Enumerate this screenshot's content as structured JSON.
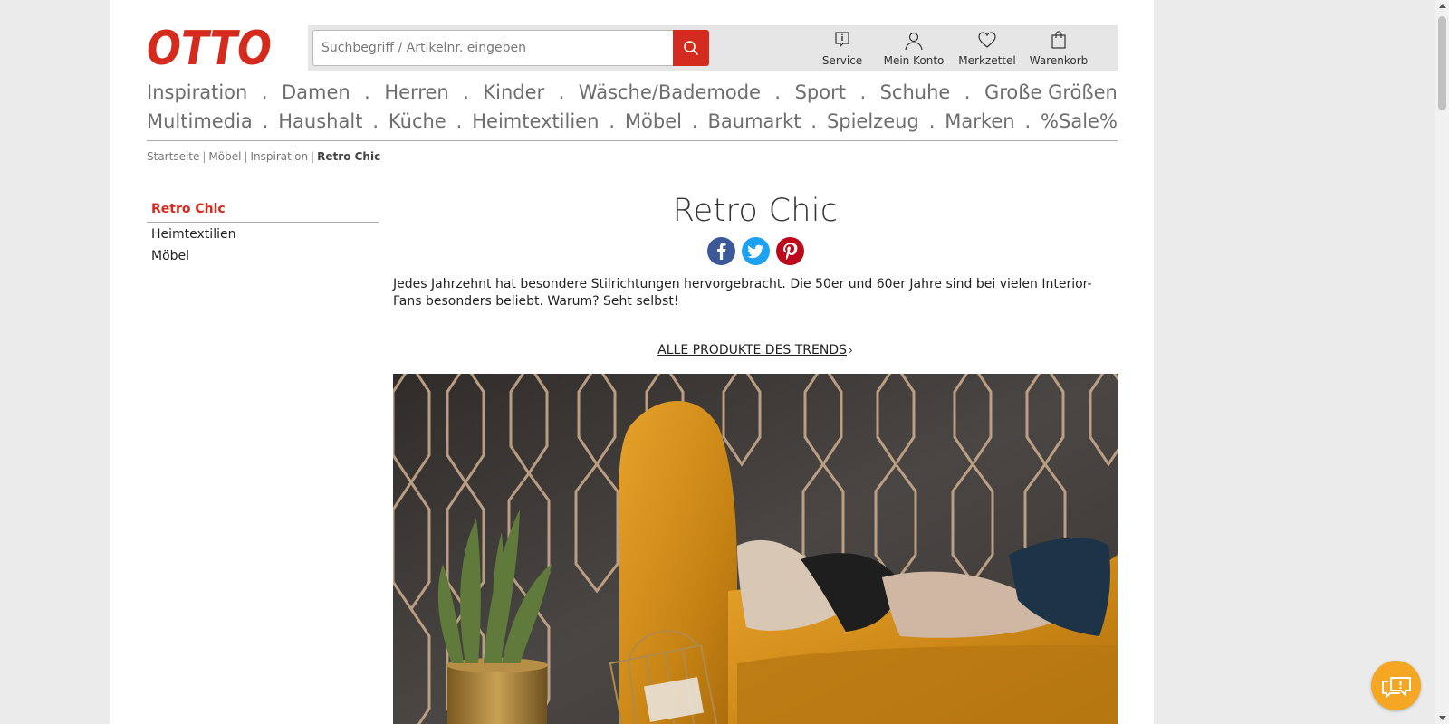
{
  "brand": {
    "logo_text": "OTTO",
    "accent": "#d52b1e"
  },
  "search": {
    "placeholder": "Suchbegriff / Artikelnr. eingeben",
    "value": "",
    "button_icon": "search-icon"
  },
  "header_links": [
    {
      "label": "Service",
      "icon": "info-icon"
    },
    {
      "label": "Mein Konto",
      "icon": "user-icon"
    },
    {
      "label": "Merkzettel",
      "icon": "heart-icon"
    },
    {
      "label": "Warenkorb",
      "icon": "shopping-bag-icon"
    }
  ],
  "nav": {
    "row1": [
      "Inspiration",
      "Damen",
      "Herren",
      "Kinder",
      "Wäsche/Bademode",
      "Sport",
      "Schuhe",
      "Große Größen"
    ],
    "row2": [
      "Multimedia",
      "Haushalt",
      "Küche",
      "Heimtextilien",
      "Möbel",
      "Baumarkt",
      "Spielzeug",
      "Marken",
      "%Sale%"
    ],
    "separator": "."
  },
  "breadcrumb": {
    "items": [
      "Startseite",
      "Möbel",
      "Inspiration"
    ],
    "current": "Retro Chic",
    "separator": "|"
  },
  "sidebar": {
    "title": "Retro Chic",
    "items": [
      "Heimtextilien",
      "Möbel"
    ]
  },
  "content": {
    "title": "Retro Chic",
    "share": [
      {
        "network": "facebook",
        "glyph": "f",
        "color": "#3b5998"
      },
      {
        "network": "twitter",
        "glyph": "t",
        "color": "#1da1f2"
      },
      {
        "network": "pinterest",
        "glyph": "p",
        "color": "#bd081c"
      }
    ],
    "intro": "Jedes Jahrzehnt hat besondere Stilrichtungen hervorgebracht. Die 50er und 60er Jahre sind bei vielen Interior-Fans besonders beliebt. Warum? Seht selbst!",
    "trend_link": "ALLE PRODUKTE DES TRENDS",
    "trend_chevron": "›"
  },
  "colors": {
    "chat": "#f5a623",
    "nav_text": "#6e6e6e",
    "header_bar": "#e6e6e6"
  },
  "chat": {
    "icon": "chat-icon"
  }
}
